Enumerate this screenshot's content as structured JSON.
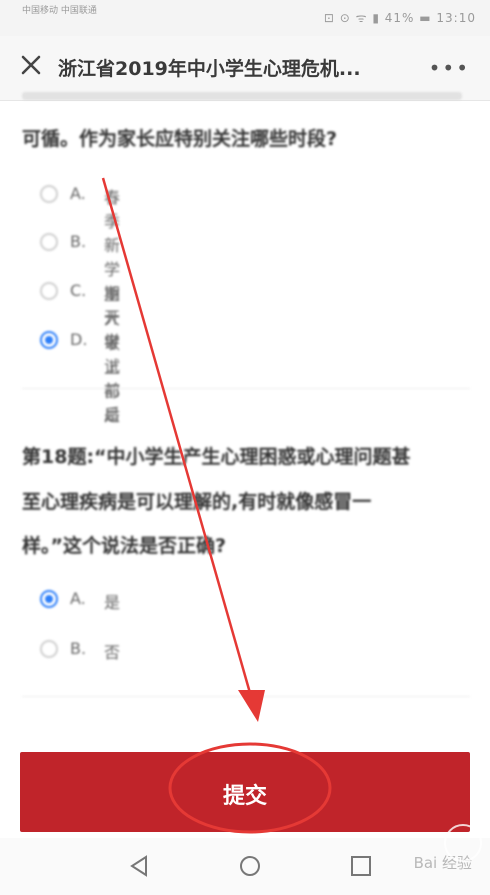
{
  "status_bar": {
    "carrier": "中国移动 中国联通",
    "right": "⊡ ⊙ ᯤ ▮ 41% ▬ 13:10"
  },
  "header": {
    "title": "浙江省2019年中小学生心理危机...",
    "more": "•••"
  },
  "question17": {
    "text_line2": "可循。作为家长应特别关注哪些时段?",
    "options": [
      {
        "letter": "A.",
        "label": "春季",
        "selected": false
      },
      {
        "letter": "B.",
        "label": "新学期开学",
        "selected": false
      },
      {
        "letter": "C.",
        "label": "重大考试前后",
        "selected": false
      },
      {
        "letter": "D.",
        "label": "以上都是",
        "selected": true
      }
    ]
  },
  "question18": {
    "line1": "第18题:“中小学生产生心理困惑或心理问题甚",
    "line2": "至心理疾病是可以理解的,有时就像感冒一",
    "line3": "样。”这个说法是否正确?",
    "options": [
      {
        "letter": "A.",
        "label": "是",
        "selected": true
      },
      {
        "letter": "B.",
        "label": "否",
        "selected": false
      }
    ]
  },
  "submit_label": "提交",
  "watermark": "Bai 经验",
  "colors": {
    "accent": "#c0242a",
    "radio_selected": "#2d7ff9",
    "annotation": "#e53935"
  },
  "icons": [
    "close-icon",
    "more-icon",
    "back-icon",
    "home-icon",
    "recents-icon"
  ]
}
